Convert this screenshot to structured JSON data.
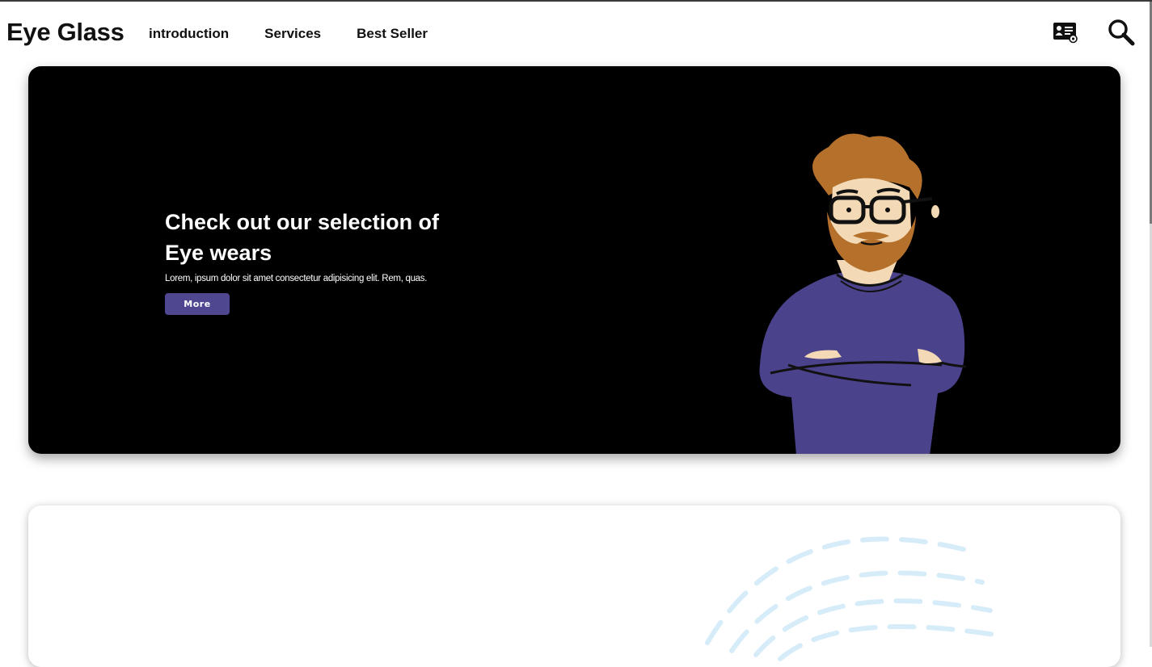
{
  "header": {
    "logo": "Eye Glass",
    "nav": [
      "introduction",
      "Services",
      "Best Seller"
    ],
    "icons": [
      "contact-card-icon",
      "search-icon"
    ]
  },
  "hero": {
    "title_line1": "Check out our selection of",
    "title_line2": "Eye wears",
    "description": "Lorem, ipsum dolor sit amet consectetur adipisicing elit. Rem, quas.",
    "button_label": "More",
    "illustration": "man-with-glasses-illustration"
  },
  "colors": {
    "accent": "#4f4790",
    "hero_bg": "#000000",
    "sweater": "#4b428c",
    "hair": "#b5702c",
    "skin": "#f3d9b5",
    "decoration": "#d6ecf8"
  }
}
